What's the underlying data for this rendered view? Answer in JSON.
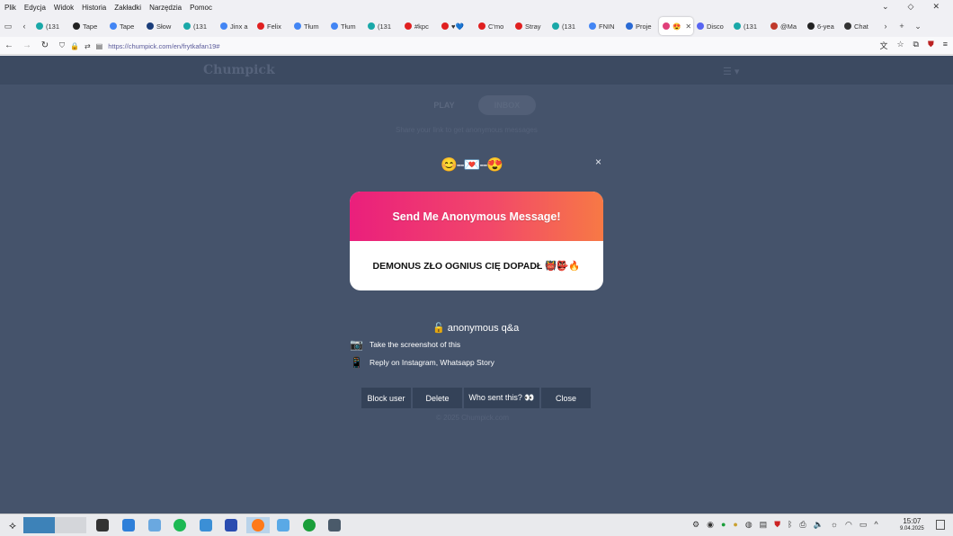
{
  "menu": [
    "Plik",
    "Edycja",
    "Widok",
    "Historia",
    "Zakładki",
    "Narzędzia",
    "Pomoc"
  ],
  "tabs": [
    {
      "label": "(131",
      "color": "#1aa8a8"
    },
    {
      "label": "Tape",
      "color": "#222222"
    },
    {
      "label": "Tape",
      "color": "#4285f4"
    },
    {
      "label": "Słow",
      "color": "#1a3d7a"
    },
    {
      "label": "(131",
      "color": "#1aa8a8"
    },
    {
      "label": "Jinx a",
      "color": "#4285f4"
    },
    {
      "label": "Felix",
      "color": "#e02020"
    },
    {
      "label": "Tłum",
      "color": "#4285f4"
    },
    {
      "label": "Tłum",
      "color": "#4285f4"
    },
    {
      "label": "(131",
      "color": "#1aa8a8"
    },
    {
      "label": "#kpc",
      "color": "#e02020"
    },
    {
      "label": "♥💙",
      "color": "#e02020"
    },
    {
      "label": "C'mo",
      "color": "#e02020"
    },
    {
      "label": "Stray",
      "color": "#e02020"
    },
    {
      "label": "(131",
      "color": "#1aa8a8"
    },
    {
      "label": "FNIN",
      "color": "#4285f4"
    },
    {
      "label": "Proje",
      "color": "#2a6ad4"
    },
    {
      "label": "😍",
      "color": "#e0407a",
      "active": true
    },
    {
      "label": "Disco",
      "color": "#5865f2"
    },
    {
      "label": "(131",
      "color": "#1aa8a8"
    },
    {
      "label": "@Ma",
      "color": "#c0392b"
    },
    {
      "label": "6-yea",
      "color": "#222222"
    },
    {
      "label": "Chat",
      "color": "#333333"
    }
  ],
  "url": "https://chumpick.com/en/frytkafan19#",
  "site": {
    "logo": "Chumpick",
    "tab_play": "PLAY",
    "tab_inbox": "INBOX",
    "subtitle": "Share your link to get anonymous messages",
    "footer": "© 2025 Chumpick.com"
  },
  "modal": {
    "emoji_row": "😊--💌--😍",
    "close": "×",
    "header": "Send Me Anonymous Message!",
    "message": "DEMONUS ZŁO OGNIUS CIĘ DOPADŁ 👹👺🔥",
    "anon_label": "🔓 anonymous q&a",
    "instructions": [
      {
        "icon": "📷",
        "text": "Take the screenshot of this"
      },
      {
        "icon": "📱",
        "text": "Reply on Instagram, Whatsapp Story"
      }
    ],
    "buttons": {
      "block": "Block user",
      "delete": "Delete",
      "who": "Who sent this? 👀",
      "close": "Close"
    }
  },
  "clock": {
    "time": "15:07",
    "date": "9.04.2025"
  }
}
